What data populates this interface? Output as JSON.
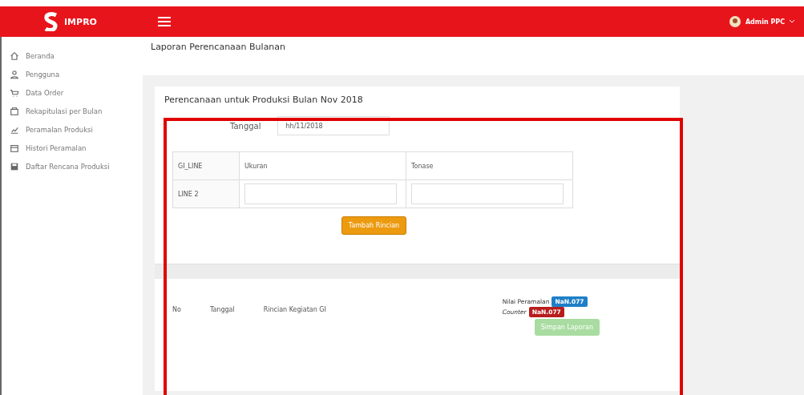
{
  "topbar": {
    "brand": "IMPRO",
    "user": "Admin PPC"
  },
  "sidebar": {
    "items": [
      {
        "label": "Beranda"
      },
      {
        "label": "Pengguna"
      },
      {
        "label": "Data Order"
      },
      {
        "label": "Rekapitulasi per Bulan"
      },
      {
        "label": "Peramalan Produksi"
      },
      {
        "label": "Histori Peramalan"
      },
      {
        "label": "Daftar Rencana Produksi"
      }
    ]
  },
  "page_title": "Laporan Perencanaan Bulanan",
  "card": {
    "title": "Perencanaan untuk Produksi Bulan Nov 2018",
    "date_label": "Tanggal",
    "date_value": "hh/11/2018",
    "table": {
      "columns": [
        "GI_LINE",
        "Ukuran",
        "Tonase"
      ],
      "rows": [
        {
          "line": "LINE 2"
        }
      ]
    },
    "add_button": "Tambah Rincian",
    "report": {
      "columns": [
        "No",
        "Tanggal",
        "Rincian Kegiatan GI"
      ],
      "forecast_label": "Nilai Peramalan",
      "forecast_badge": "NaN.077",
      "counter_label": "Counter",
      "counter_badge": "NaN.077",
      "save_button": "Simpan Laporan",
      "save_disabled": true
    }
  }
}
